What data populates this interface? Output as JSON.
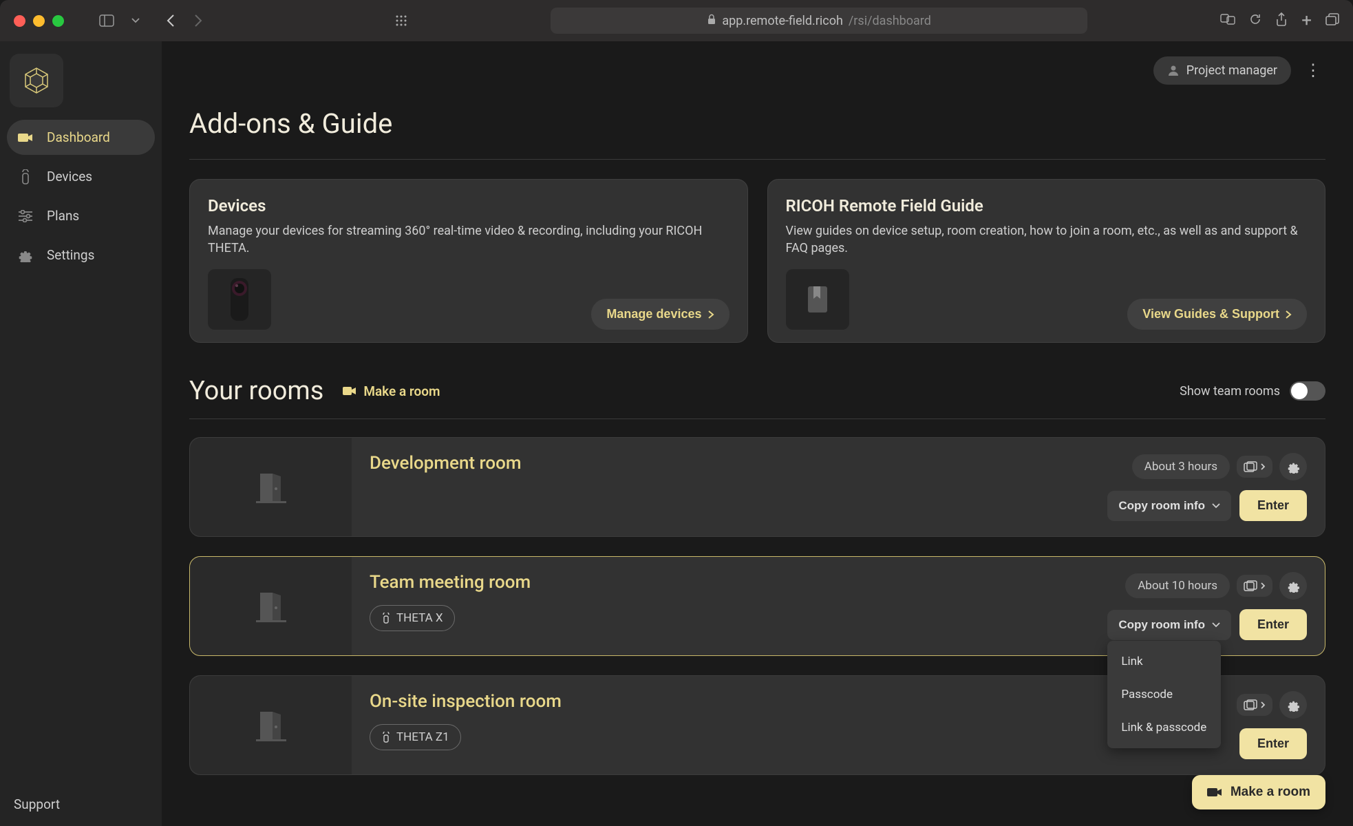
{
  "browser": {
    "url_host": "app.remote-field.ricoh",
    "url_path": "/rsi/dashboard"
  },
  "user_chip": "Project manager",
  "sidebar": {
    "items": [
      {
        "label": "Dashboard",
        "icon": "camera"
      },
      {
        "label": "Devices",
        "icon": "remote"
      },
      {
        "label": "Plans",
        "icon": "sliders"
      },
      {
        "label": "Settings",
        "icon": "gear"
      }
    ],
    "support": "Support"
  },
  "addons": {
    "title": "Add-ons & Guide",
    "cards": [
      {
        "title": "Devices",
        "desc": "Manage your devices for streaming 360° real-time video & recording, including your RICOH THETA.",
        "button": "Manage devices"
      },
      {
        "title": "RICOH Remote Field Guide",
        "desc": "View guides on device setup, room creation, how to join a room, etc., as well as and support & FAQ pages.",
        "button": "View Guides & Support"
      }
    ]
  },
  "rooms": {
    "title": "Your rooms",
    "make_room": "Make a room",
    "show_team": "Show team rooms",
    "copy_label": "Copy room info",
    "enter_label": "Enter",
    "menu": [
      "Link",
      "Passcode",
      "Link & passcode"
    ],
    "list": [
      {
        "name": "Development room",
        "time": "About 3 hours",
        "device": null
      },
      {
        "name": "Team meeting room",
        "time": "About 10 hours",
        "device": "THETA X"
      },
      {
        "name": "On-site inspection room",
        "time": "",
        "device": "THETA Z1"
      }
    ]
  },
  "fab": "Make a room"
}
